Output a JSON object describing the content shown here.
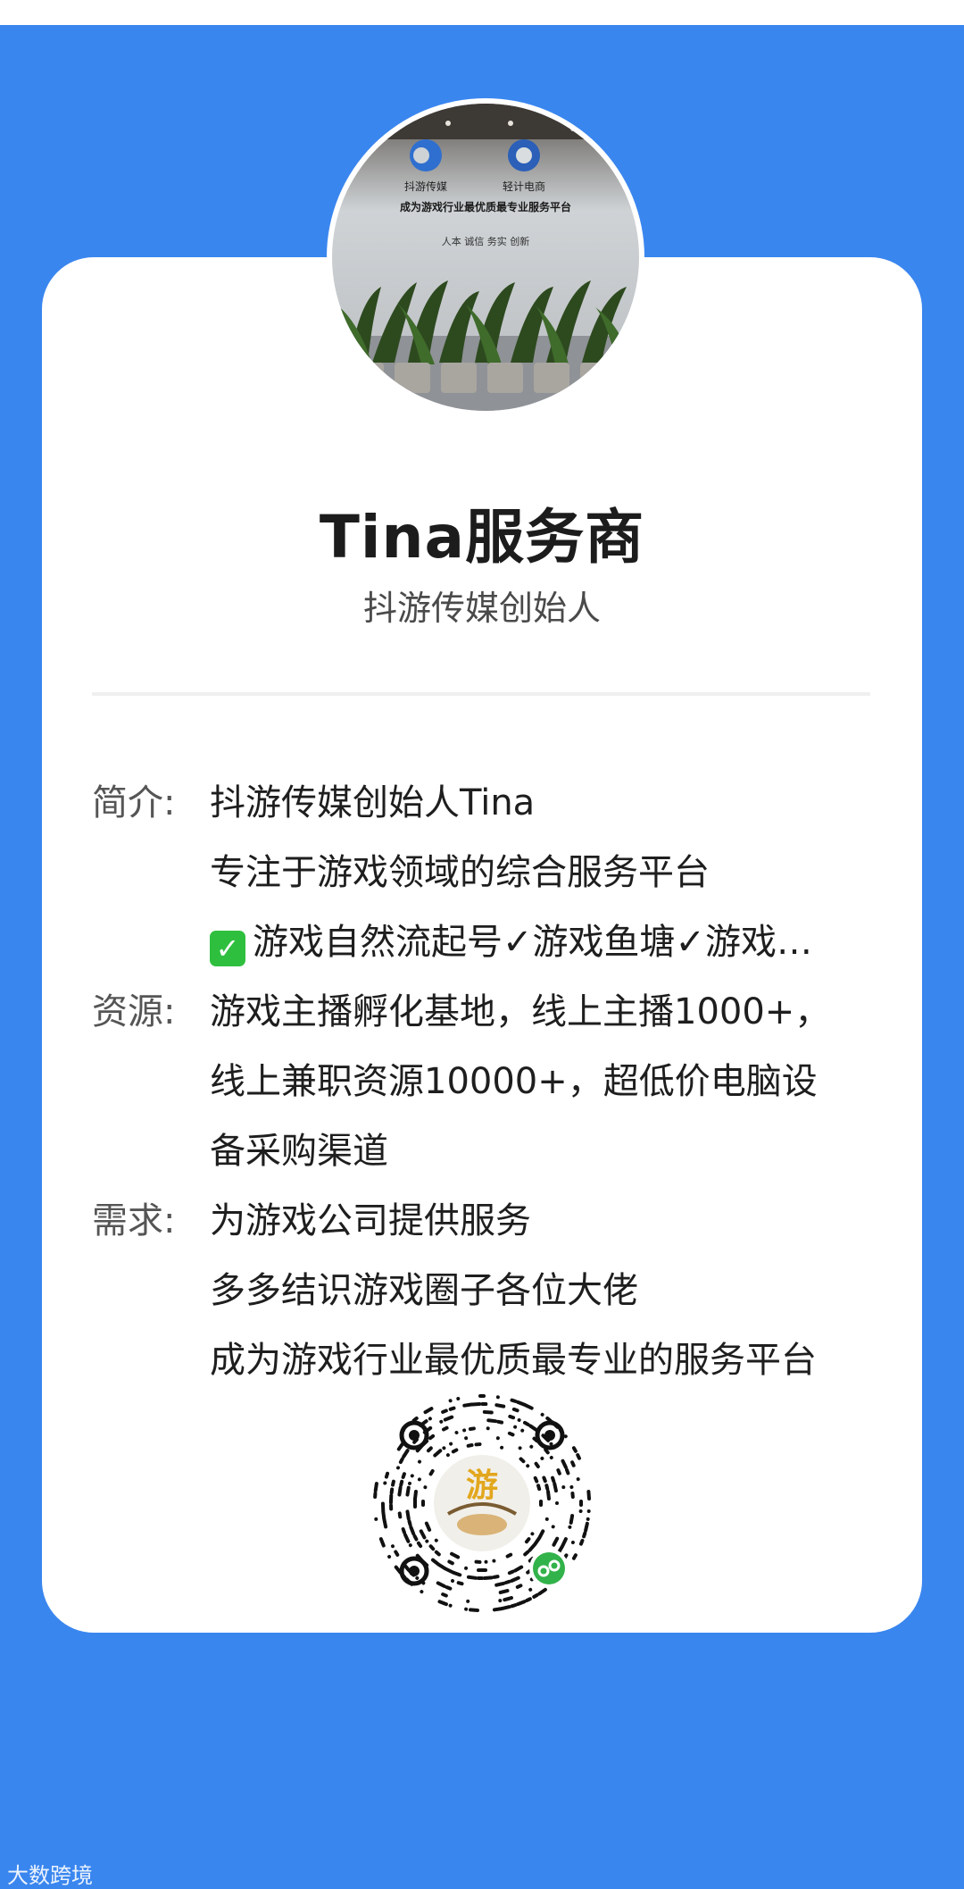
{
  "colors": {
    "background": "#3a86ef",
    "card": "#ffffff",
    "name_text": "#1c1c1c",
    "label_text": "#555555"
  },
  "profile": {
    "avatar_icon": "company-lobby-photo",
    "avatar_text": {
      "left_logo": "抖游传媒",
      "right_logo": "轻计电商",
      "slogan": "成为游戏行业最优质最专业服务平台",
      "values": "人本 诚信 务实 创新"
    },
    "name": "Tina服务商",
    "title": "抖游传媒创始人"
  },
  "info": {
    "intro": {
      "label": "简介:",
      "lines": [
        "抖游传媒创始人Tina",
        "专注于游戏领域的综合服务平台",
        "游戏自然流起号✓游戏鱼塘✓游戏…"
      ],
      "check_icon": "✅"
    },
    "resources": {
      "label": "资源:",
      "lines": [
        "游戏主播孵化基地，线上主播1000+，",
        "线上兼职资源10000+，超低价电脑设",
        "备采购渠道"
      ]
    },
    "needs": {
      "label": "需求:",
      "lines": [
        "为游戏公司提供服务",
        "多多结识游戏圈子各位大佬",
        "成为游戏行业最优质最专业的服务平台"
      ]
    }
  },
  "qr": {
    "center_text": "游",
    "icon": "mini-program-qr-code",
    "badge_icon": "mini-program-badge-icon"
  },
  "footer": {
    "watermark": "大数跨境"
  }
}
